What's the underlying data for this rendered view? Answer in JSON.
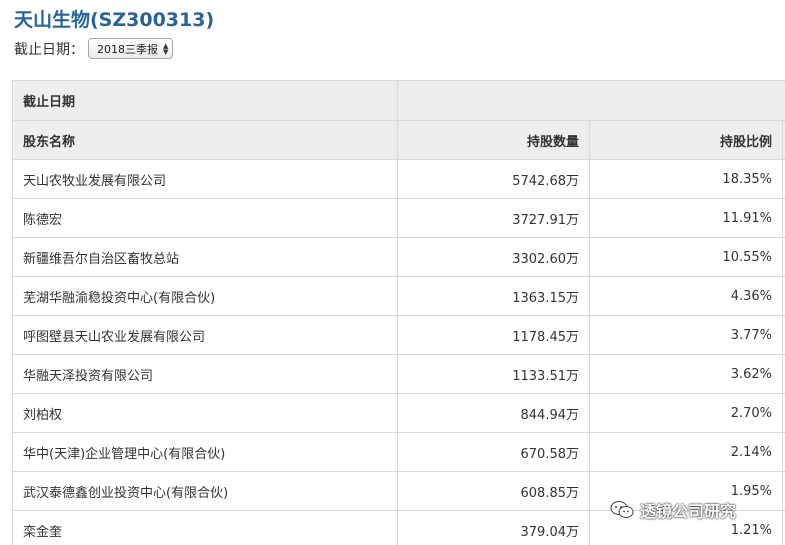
{
  "page": {
    "title": "天山生物(SZ300313)",
    "date_label": "截止日期：",
    "date_select": "2018三季报"
  },
  "table": {
    "header_date": "截止日期",
    "columns": [
      "股东名称",
      "持股数量",
      "持股比例"
    ],
    "rows": [
      {
        "name": "天山农牧业发展有限公司",
        "shares": "5742.68万",
        "ratio": "18.35%"
      },
      {
        "name": "陈德宏",
        "shares": "3727.91万",
        "ratio": "11.91%"
      },
      {
        "name": "新疆维吾尔自治区畜牧总站",
        "shares": "3302.60万",
        "ratio": "10.55%"
      },
      {
        "name": "芜湖华融渝稳投资中心(有限合伙)",
        "shares": "1363.15万",
        "ratio": "4.36%"
      },
      {
        "name": "呼图壁县天山农业发展有限公司",
        "shares": "1178.45万",
        "ratio": "3.77%"
      },
      {
        "name": "华融天泽投资有限公司",
        "shares": "1133.51万",
        "ratio": "3.62%"
      },
      {
        "name": "刘柏权",
        "shares": "844.94万",
        "ratio": "2.70%"
      },
      {
        "name": "华中(天津)企业管理中心(有限合伙)",
        "shares": "670.58万",
        "ratio": "2.14%"
      },
      {
        "name": "武汉泰德鑫创业投资中心(有限合伙)",
        "shares": "608.85万",
        "ratio": "1.95%"
      },
      {
        "name": "栾金奎",
        "shares": "379.04万",
        "ratio": "1.21%"
      }
    ]
  },
  "watermark": {
    "text": "透镜公司研究",
    "icon": "wechat-icon"
  }
}
